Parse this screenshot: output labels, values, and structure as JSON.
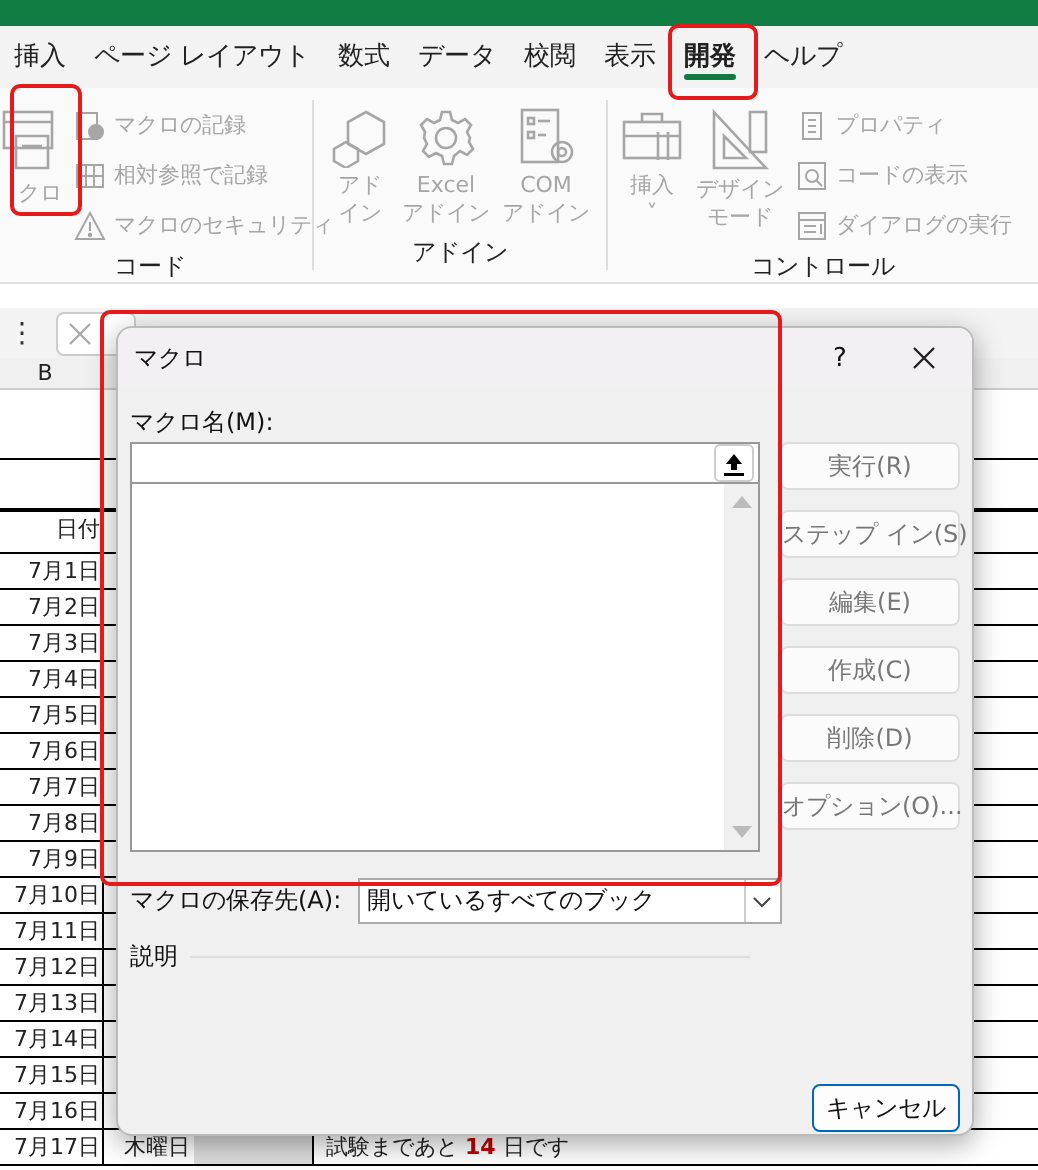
{
  "ribbon": {
    "tabs": [
      {
        "label": "挿入",
        "selected": false
      },
      {
        "label": "ページ レイアウト",
        "selected": false
      },
      {
        "label": "数式",
        "selected": false
      },
      {
        "label": "データ",
        "selected": false
      },
      {
        "label": "校閲",
        "selected": false
      },
      {
        "label": "表示",
        "selected": false
      },
      {
        "label": "開発",
        "selected": true
      },
      {
        "label": "ヘルプ",
        "selected": false
      }
    ],
    "groups": [
      {
        "label": "コード",
        "large": [
          {
            "lines": [
              "クロ"
            ],
            "kind": "macro",
            "disabled": true
          }
        ],
        "small": [
          {
            "label": "マクロの記録",
            "kind": "record",
            "disabled": true
          },
          {
            "label": "相対参照で記録",
            "kind": "grid",
            "disabled": true
          },
          {
            "label": "マクロのセキュリティ",
            "kind": "warning",
            "disabled": true
          }
        ]
      },
      {
        "label": "アドイン",
        "large": [
          {
            "lines": [
              "アド",
              "イン"
            ],
            "kind": "hexagon",
            "disabled": true
          },
          {
            "lines": [
              "Excel",
              "アドイン"
            ],
            "kind": "gear",
            "disabled": true
          },
          {
            "lines": [
              "COM",
              "アドイン"
            ],
            "kind": "list-gear",
            "disabled": true
          }
        ]
      },
      {
        "label": "コントロール",
        "large": [
          {
            "lines": [
              "挿入",
              "˅"
            ],
            "kind": "toolbox",
            "disabled": true
          },
          {
            "lines": [
              "デザイン",
              "モード"
            ],
            "kind": "triangle",
            "disabled": true
          }
        ],
        "small": [
          {
            "label": "プロパティ",
            "kind": "properties",
            "disabled": true
          },
          {
            "label": "コードの表示",
            "kind": "view",
            "disabled": true
          },
          {
            "label": "ダイアログの実行",
            "kind": "dialog",
            "disabled": true
          }
        ]
      }
    ]
  },
  "formula_bar": {
    "menu": "⋮"
  },
  "sheet": {
    "column_header": "B",
    "header": "日付",
    "rows": [
      {
        "date": "7月1日"
      },
      {
        "date": "7月2日"
      },
      {
        "date": "7月3日"
      },
      {
        "date": "7月4日"
      },
      {
        "date": "7月5日"
      },
      {
        "date": "7月6日"
      },
      {
        "date": "7月7日"
      },
      {
        "date": "7月8日"
      },
      {
        "date": "7月9日"
      },
      {
        "date": "7月10日"
      },
      {
        "date": "7月11日"
      },
      {
        "date": "7月12日"
      },
      {
        "date": "7月13日"
      },
      {
        "date": "7月14日"
      },
      {
        "date": "7月15日"
      },
      {
        "date": "7月16日"
      },
      {
        "date": "7月17日",
        "day": "木曜日",
        "note": "試験まであと **14** 日です"
      }
    ]
  },
  "dialog": {
    "title": "マクロ",
    "help": "?",
    "name_label": "マクロ名(M):",
    "buttons": [
      {
        "label": "実行(R)",
        "disabled": true
      },
      {
        "label": "ステップ イン(S)",
        "disabled": true
      },
      {
        "label": "編集(E)",
        "disabled": true
      },
      {
        "label": "作成(C)",
        "disabled": true
      },
      {
        "label": "削除(D)",
        "disabled": true
      },
      {
        "label": "オプション(O)...",
        "disabled": true
      }
    ],
    "location_label": "マクロの保存先(A):",
    "location_value": "開いているすべてのブック",
    "description_label": "説明",
    "cancel": "キャンセル"
  }
}
